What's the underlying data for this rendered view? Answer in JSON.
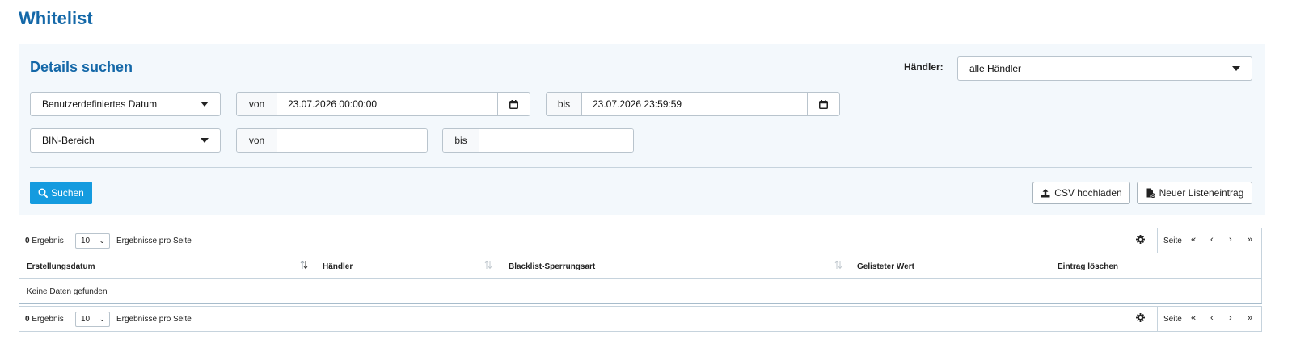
{
  "page": {
    "title": "Whitelist"
  },
  "search": {
    "title": "Details suchen",
    "merchant_label": "Händler:",
    "merchant_value": "alle Händler",
    "date_mode": "Benutzerdefiniertes Datum",
    "date_from_label": "von",
    "date_from_value": "23.07.2026 00:00:00",
    "date_to_label": "bis",
    "date_to_value": "23.07.2026 23:59:59",
    "range_mode": "BIN-Bereich",
    "range_from_label": "von",
    "range_from_value": "",
    "range_to_label": "bis",
    "range_to_value": "",
    "search_button": "Suchen",
    "csv_button": "CSV hochladen",
    "new_entry_button": "Neuer Listeneintrag"
  },
  "table_top": {
    "count_number": "0",
    "count_label": "Ergebnis",
    "page_size": "10",
    "per_page_label": "Ergebnisse pro Seite",
    "page_label": "Seite",
    "nav_first": "«",
    "nav_prev": "‹",
    "nav_next": "›",
    "nav_last": "»"
  },
  "table_bottom": {
    "count_number": "0",
    "count_label": "Ergebnis",
    "page_size": "10",
    "per_page_label": "Ergebnisse pro Seite",
    "page_label": "Seite",
    "nav_first": "«",
    "nav_prev": "‹",
    "nav_next": "›",
    "nav_last": "»"
  },
  "table": {
    "columns": [
      "Erstellungsdatum",
      "Händler",
      "Blacklist-Sperrungsart",
      "Gelisteter Wert",
      "Eintrag löschen"
    ],
    "empty_message": "Keine Daten gefunden"
  },
  "icons": {
    "calendar": "calendar-icon",
    "search": "search-icon",
    "upload": "upload-icon",
    "new_file": "file-plus-icon",
    "settings": "gear-icon",
    "sort": "sort-icon"
  },
  "colors": {
    "title": "#1468a8",
    "primary_button": "#149bdf",
    "panel_background": "#f3f8fc"
  }
}
